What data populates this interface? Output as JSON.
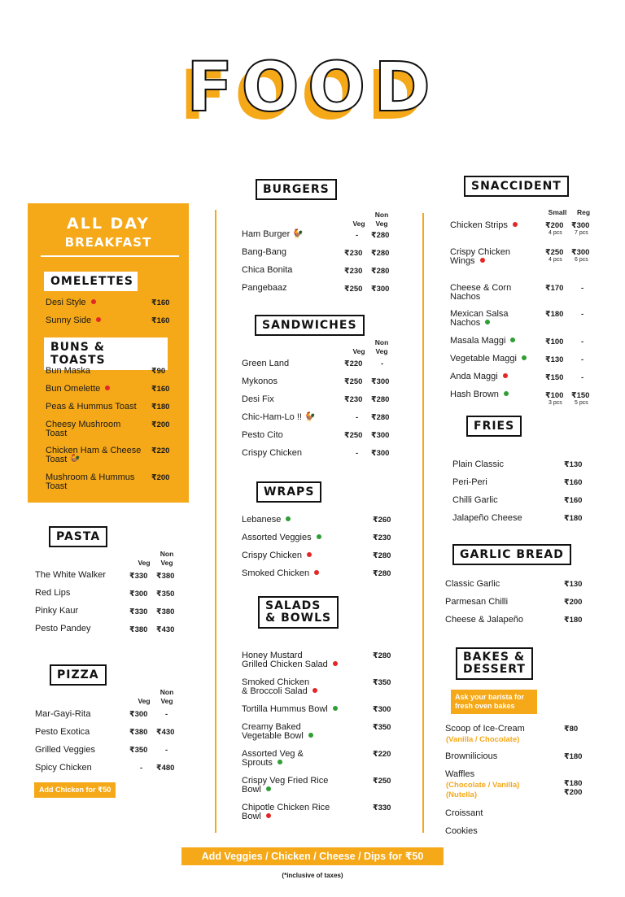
{
  "title": "FOOD",
  "breakfast": {
    "title1": "ALL DAY",
    "title2": "BREAKFAST",
    "omelettes_title": "OMELETTES",
    "omelettes": [
      {
        "name": "Desi Style",
        "price": "₹160"
      },
      {
        "name": "Sunny Side",
        "price": "₹160"
      }
    ],
    "buns_title": "BUNS & TOASTS",
    "buns": [
      {
        "name": "Bun Maska",
        "price": "₹90"
      },
      {
        "name": "Bun Omelette",
        "price": "₹160"
      },
      {
        "name": "Peas & Hummus Toast",
        "price": "₹180"
      },
      {
        "name": "Cheesy Mushroom",
        "name2": "Toast",
        "price": "₹200"
      },
      {
        "name": "Chicken Ham & Cheese",
        "name2": "Toast",
        "price": "₹220"
      },
      {
        "name": "Mushroom & Hummus",
        "name2": "Toast",
        "price": "₹200"
      }
    ]
  },
  "pasta": {
    "title": "PASTA",
    "veg": "Veg",
    "nonveg1": "Non",
    "nonveg2": "Veg",
    "items": [
      {
        "name": "The White Walker",
        "veg": "₹330",
        "nonveg": "₹380"
      },
      {
        "name": "Red Lips",
        "veg": "₹300",
        "nonveg": "₹350"
      },
      {
        "name": "Pinky Kaur",
        "veg": "₹330",
        "nonveg": "₹380"
      },
      {
        "name": "Pesto Pandey",
        "veg": "₹380",
        "nonveg": "₹430"
      }
    ]
  },
  "pizza": {
    "title": "PIZZA",
    "veg": "Veg",
    "nonveg1": "Non",
    "nonveg2": "Veg",
    "items": [
      {
        "name": "Mar-Gayi-Rita",
        "veg": "₹300",
        "nonveg": "-"
      },
      {
        "name": "Pesto Exotica",
        "veg": "₹380",
        "nonveg": "₹430"
      },
      {
        "name": "Grilled Veggies",
        "veg": "₹350",
        "nonveg": "-"
      },
      {
        "name": "Spicy Chicken",
        "veg": "-",
        "nonveg": "₹480"
      }
    ],
    "addon": "Add Chicken for ₹50"
  },
  "burgers": {
    "title": "BURGERS",
    "veg": "Veg",
    "nonveg1": "Non",
    "nonveg2": "Veg",
    "items": [
      {
        "name": "Ham Burger",
        "veg": "-",
        "nonveg": "₹280"
      },
      {
        "name": "Bang-Bang",
        "veg": "₹230",
        "nonveg": "₹280"
      },
      {
        "name": "Chica Bonita",
        "veg": "₹230",
        "nonveg": "₹280"
      },
      {
        "name": "Pangebaaz",
        "veg": "₹250",
        "nonveg": "₹300"
      }
    ]
  },
  "sandwiches": {
    "title": "SANDWICHES",
    "veg": "Veg",
    "nonveg1": "Non",
    "nonveg2": "Veg",
    "items": [
      {
        "name": "Green Land",
        "veg": "₹220",
        "nonveg": "-"
      },
      {
        "name": "Mykonos",
        "veg": "₹250",
        "nonveg": "₹300"
      },
      {
        "name": "Desi Fix",
        "veg": "₹230",
        "nonveg": "₹280"
      },
      {
        "name": "Chic-Ham-Lo !!",
        "veg": "-",
        "nonveg": "₹280"
      },
      {
        "name": "Pesto Cito",
        "veg": "₹250",
        "nonveg": "₹300"
      },
      {
        "name": "Crispy Chicken",
        "veg": "-",
        "nonveg": "₹300"
      }
    ]
  },
  "wraps": {
    "title": "WRAPS",
    "items": [
      {
        "name": "Lebanese",
        "price": "₹260"
      },
      {
        "name": "Assorted Veggies",
        "price": "₹230"
      },
      {
        "name": "Crispy Chicken",
        "price": "₹280"
      },
      {
        "name": "Smoked Chicken",
        "price": "₹280"
      }
    ]
  },
  "salads": {
    "title1": "SALADS",
    "title2": "& BOWLS",
    "items": [
      {
        "name": "Honey Mustard",
        "name2": "Grilled Chicken Salad",
        "price": "₹280"
      },
      {
        "name": "Smoked Chicken",
        "name2": "& Broccoli Salad",
        "price": "₹350"
      },
      {
        "name": "Tortilla Hummus Bowl",
        "price": "₹300"
      },
      {
        "name": "Creamy Baked",
        "name2": "Vegetable Bowl",
        "price": "₹350"
      },
      {
        "name": "Assorted Veg &",
        "name2": "Sprouts",
        "price": "₹220"
      },
      {
        "name": "Crispy Veg Fried Rice",
        "name2": "Bowl",
        "price": "₹250"
      },
      {
        "name": "Chipotle Chicken Rice",
        "name2": "Bowl",
        "price": "₹330"
      }
    ]
  },
  "snaccident": {
    "title": "SNACCIDENT",
    "small": "Small",
    "reg": "Reg",
    "items": [
      {
        "name": "Chicken Strips",
        "small": "₹200",
        "small_sub": "4 pcs",
        "reg": "₹300",
        "reg_sub": "7 pcs"
      },
      {
        "name": "Crispy Chicken",
        "name2": "Wings",
        "small": "₹250",
        "small_sub": "4 pcs",
        "reg": "₹300",
        "reg_sub": "6 pcs"
      },
      {
        "name": "Cheese & Corn",
        "name2": "Nachos",
        "small": "₹170",
        "reg": "-"
      },
      {
        "name": "Mexican Salsa",
        "name2": "Nachos",
        "small": "₹180",
        "reg": "-"
      },
      {
        "name": "Masala Maggi",
        "small": "₹100",
        "reg": "-"
      },
      {
        "name": "Vegetable Maggi",
        "small": "₹130",
        "reg": "-"
      },
      {
        "name": "Anda Maggi",
        "small": "₹150",
        "reg": "-"
      },
      {
        "name": "Hash Brown",
        "small": "₹100",
        "small_sub": "3 pcs",
        "reg": "₹150",
        "reg_sub": "5 pcs"
      }
    ]
  },
  "fries": {
    "title": "FRIES",
    "items": [
      {
        "name": "Plain Classic",
        "price": "₹130"
      },
      {
        "name": "Peri-Peri",
        "price": "₹160"
      },
      {
        "name": "Chilli Garlic",
        "price": "₹160"
      },
      {
        "name": "Jalapeño Cheese",
        "price": "₹180"
      }
    ]
  },
  "garlic": {
    "title": "GARLIC BREAD",
    "items": [
      {
        "name": "Classic Garlic",
        "price": "₹130"
      },
      {
        "name": "Parmesan Chilli",
        "price": "₹200"
      },
      {
        "name": "Cheese & Jalapeño",
        "price": "₹180"
      }
    ]
  },
  "bakes": {
    "title1": "BAKES &",
    "title2": "DESSERT",
    "note1": "Ask your barista for",
    "note2": "fresh oven bakes",
    "scoop": "Scoop of Ice-Cream",
    "scoop_opt": "(Vanilla / Chocolate)",
    "scoop_price": "₹80",
    "brown": "Brownilicious",
    "brown_price": "₹180",
    "waffles": "Waffles",
    "waffles_opt1": "(Chocolate / Vanilla)",
    "waffles_opt2": "(Nutella)",
    "waffles_price1": "₹180",
    "waffles_price2": "₹200",
    "croissant": "Croissant",
    "cookies": "Cookies"
  },
  "footer": "Add Veggies / Chicken / Cheese / Dips for ₹50",
  "footnote": "(*inclusive of taxes)"
}
